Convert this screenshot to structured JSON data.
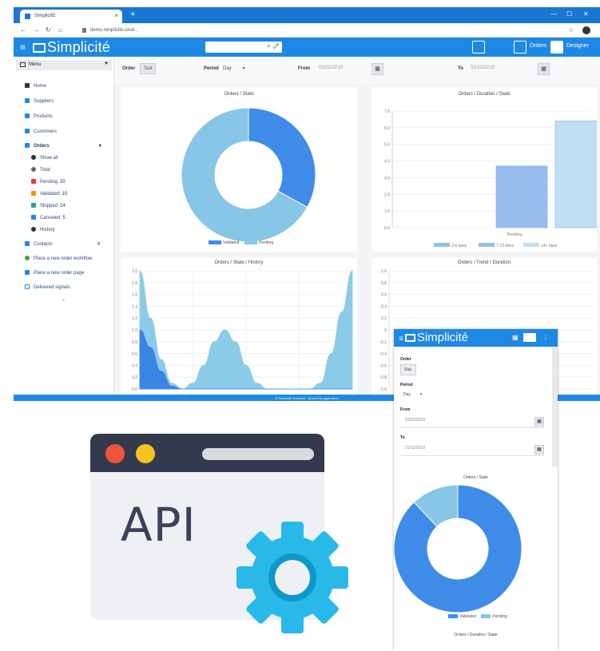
{
  "browser": {
    "tab_title": "SimplicitE",
    "tab_close": "×",
    "new_tab": "+",
    "url": "demo.simplicite.io/ui/...",
    "window_controls": [
      "—",
      "☐",
      "✕"
    ]
  },
  "app": {
    "brand": "Simplicité",
    "header_user": "Orders",
    "header_user2": "Designer"
  },
  "sidebar": {
    "menu_label": "Menu",
    "items": [
      {
        "label": "Home",
        "color": "#333333"
      },
      {
        "label": "Suppliers",
        "color": "#1e88e5"
      },
      {
        "label": "Products",
        "color": "#1e88e5"
      },
      {
        "label": "Customers",
        "color": "#1e88e5"
      },
      {
        "label": "Orders",
        "color": "#1e88e5"
      },
      {
        "label": "Show all",
        "color": "#333333"
      },
      {
        "label": "Total",
        "color": "#666666"
      },
      {
        "label": "Pending",
        "count": "20",
        "color": "#e53935"
      },
      {
        "label": "Validated",
        "count": "15",
        "color": "#fb8c00"
      },
      {
        "label": "Shipped",
        "count": "14",
        "color": "#26a69a"
      },
      {
        "label": "Canceled",
        "count": "5",
        "color": "#1e88e5"
      },
      {
        "label": "History",
        "color": "#333333"
      },
      {
        "label": "Contacts",
        "count": "4",
        "color": "#1e88e5"
      },
      {
        "label": "Place a new order workflow",
        "color": "#43a047"
      },
      {
        "label": "Place a new order page",
        "color": "#1e88e5"
      },
      {
        "label": "Delivered signals",
        "color": "#1e88e5"
      }
    ]
  },
  "filters": {
    "order_label": "Order",
    "order_value": "Stat",
    "period_label": "Period",
    "period_value": "Day",
    "from_label": "From",
    "from_value": "01/01/2019",
    "to_label": "To",
    "to_value": "31/12/2019",
    "calendar_glyph": "▦"
  },
  "panels": {
    "orders_state_title": "Orders / State",
    "orders_duration_title": "Orders / Duration / State",
    "orders_history_title": "Orders / State / History",
    "orders_trend_title": "Orders / Trend / Duration"
  },
  "chart_data": [
    {
      "type": "pie",
      "title": "Orders / State",
      "labels": [
        "Validated",
        "Pending"
      ],
      "values": [
        33,
        67
      ],
      "colors": [
        "#3f8ce8",
        "#87c6e6"
      ],
      "donut": true,
      "legend_position": "bottom"
    },
    {
      "type": "bar",
      "title": "Orders / Duration / State",
      "categories": [
        "Pending"
      ],
      "series": [
        {
          "name": "0-6 days",
          "values": [
            0
          ],
          "color": "#8fc3e6"
        },
        {
          "name": "7-13 days",
          "values": [
            3.7
          ],
          "color": "#97bdef"
        },
        {
          "name": "14+ days",
          "values": [
            6.4
          ],
          "color": "#bfe0f3"
        }
      ],
      "ylim": [
        0,
        7
      ],
      "yticks": [
        "0.0",
        "1.0",
        "2.0",
        "3.0",
        "4.0",
        "5.0",
        "6.0",
        "7.0"
      ],
      "legend_position": "bottom"
    },
    {
      "type": "area",
      "title": "Orders / State / History",
      "x": [
        0,
        1,
        2,
        3,
        4,
        5,
        6,
        7,
        8,
        9,
        10,
        11,
        12,
        13,
        14,
        15,
        16,
        17,
        18,
        19,
        20
      ],
      "series": [
        {
          "name": "Pending",
          "values": [
            2.0,
            1.2,
            0.5,
            0.1,
            0,
            0.1,
            0.4,
            0.8,
            1.0,
            0.8,
            0.4,
            0.1,
            0,
            0,
            0,
            0,
            0,
            0.1,
            0.6,
            1.3,
            2.0
          ],
          "color": "#8ccbe8"
        },
        {
          "name": "Validated",
          "values": [
            1.0,
            0.7,
            0.3,
            0.05,
            0,
            0,
            0,
            0,
            0,
            0,
            0,
            0,
            0,
            0,
            0,
            0,
            0,
            0,
            0,
            0,
            0
          ],
          "color": "#3a84e4"
        }
      ],
      "ylim": [
        0,
        2
      ],
      "yticks": [
        "0.0",
        "0.2",
        "0.4",
        "0.6",
        "0.8",
        "1.0",
        "1.2",
        "1.4",
        "1.6",
        "1.8",
        "2.0"
      ]
    },
    {
      "type": "bar",
      "title": "Orders / Trend / Duration",
      "categories": [],
      "series": [],
      "ylim": [
        -1,
        1
      ],
      "yticks": [
        "1.0",
        "0.8",
        "0.6",
        "0.4",
        "0.2",
        "0",
        "-0.2",
        "-0.4",
        "-0.6",
        "-0.8",
        "-1.0"
      ]
    }
  ],
  "statusbar": {
    "text": "© Simplicité Software · About this application"
  },
  "api_illustration": {
    "label": "API",
    "dot_colors": [
      "#f0533c",
      "#f6c21c"
    ],
    "gear_color": "#28b9e9",
    "gear_inner_color": "#0e98c7"
  },
  "mobile": {
    "brand": "Simplicité",
    "order_label": "Order",
    "order_value": "Stat",
    "period_label": "Period",
    "period_value": "Day",
    "from_label": "From",
    "from_value": "01/01/2019",
    "to_label": "To",
    "to_value": "31/12/2019",
    "chart_title": "Orders / State",
    "footer_title": "Orders / Duration / State",
    "chart": {
      "type": "pie",
      "labels": [
        "Validated",
        "Pending"
      ],
      "values": [
        88,
        12
      ],
      "colors": [
        "#3f8ce8",
        "#87c6e6"
      ],
      "donut": true
    }
  }
}
